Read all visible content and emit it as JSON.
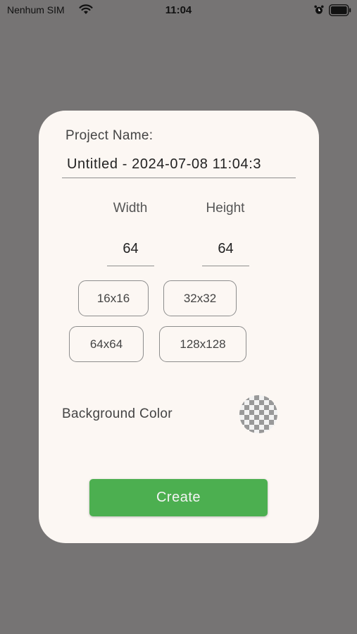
{
  "status_bar": {
    "carrier": "Nenhum SIM",
    "time": "11:04",
    "icons": [
      "wifi-icon",
      "alarm-icon",
      "battery-icon"
    ]
  },
  "dialog": {
    "project_name_label": "Project Name:",
    "project_name_value": "Untitled - 2024-07-08 11:04:3",
    "width_label": "Width",
    "height_label": "Height",
    "width_value": "64",
    "height_value": "64",
    "presets": [
      "16x16",
      "32x32",
      "64x64",
      "128x128"
    ],
    "background_color_label": "Background Color",
    "background_color_swatch": "transparent-checkerboard",
    "create_label": "Create"
  },
  "colors": {
    "backdrop": "#767474",
    "dialog_background": "#fcf7f3",
    "create_button": "#4caf50"
  }
}
